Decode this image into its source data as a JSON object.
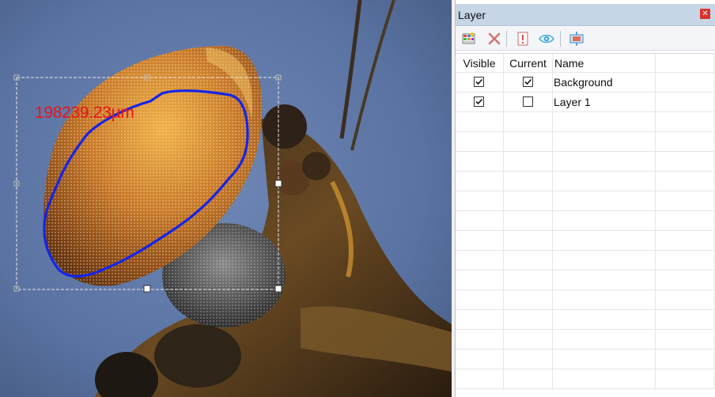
{
  "canvas": {
    "measurement_label": "198239.23µm"
  },
  "panel": {
    "title": "Layer",
    "close_icon": "close-icon",
    "toolbar": [
      {
        "name": "new-layer-icon"
      },
      {
        "name": "delete-layer-icon"
      },
      {
        "name": "layer-properties-icon"
      },
      {
        "name": "toggle-visibility-icon"
      },
      {
        "name": "merge-layer-icon"
      }
    ],
    "columns": [
      "Visible",
      "Current",
      "Name"
    ],
    "layers": [
      {
        "name": "Background",
        "visible": true,
        "current": true
      },
      {
        "name": "Layer 1",
        "visible": true,
        "current": false
      }
    ]
  },
  "colors": {
    "header_bg": "#c7d6e6",
    "outline": "#1525e8",
    "label": "#e8141a"
  }
}
